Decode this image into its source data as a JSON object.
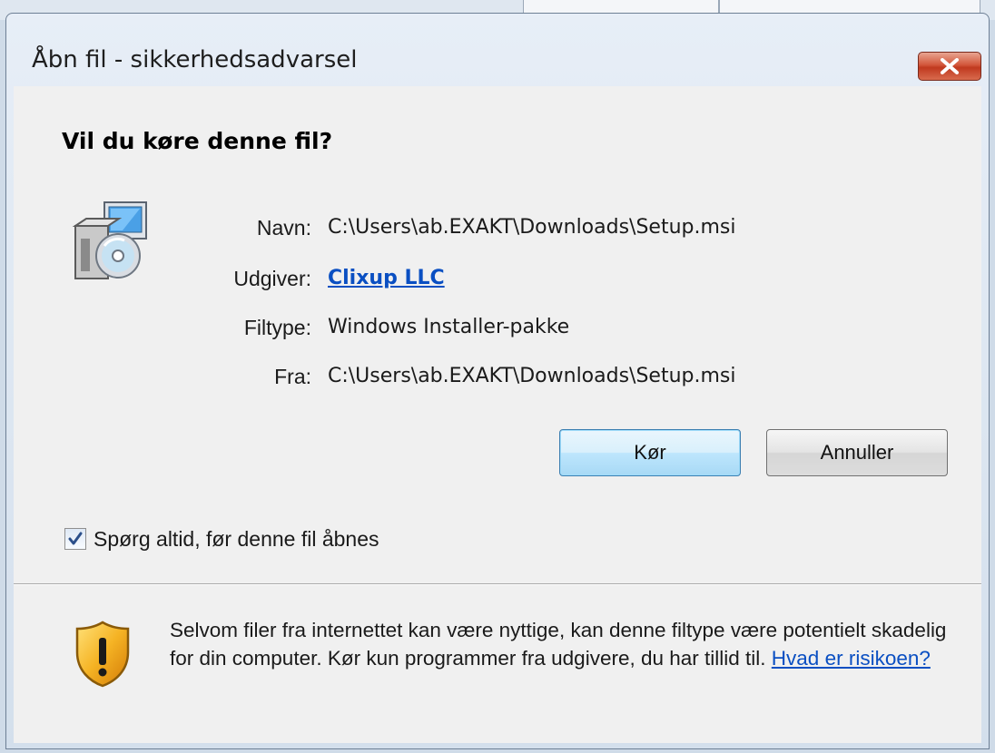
{
  "dialog": {
    "title": "Åbn fil - sikkerhedsadvarsel",
    "heading": "Vil du køre denne fil?",
    "fields": [
      {
        "label": "Navn:",
        "value": "C:\\Users\\ab.EXAKT\\Downloads\\Setup.msi"
      },
      {
        "label": "Udgiver:",
        "value": "Clixup LLC"
      },
      {
        "label": "Filtype:",
        "value": "Windows Installer-pakke"
      },
      {
        "label": "Fra:",
        "value": "C:\\Users\\ab.EXAKT\\Downloads\\Setup.msi"
      }
    ],
    "buttons": {
      "run": "Kør",
      "cancel": "Annuller"
    },
    "checkbox": {
      "label": "Spørg altid, før denne fil åbnes",
      "checked": true
    },
    "warning": {
      "text": "Selvom filer fra internettet kan være nyttige, kan denne filtype være potentielt skadelig for din computer. Kør kun programmer fra udgivere, du har tillid til.",
      "link": "Hvad er risikoen?"
    }
  },
  "icons": {
    "close": "close-icon",
    "app": "installer-package-icon",
    "checkbox": "checkmark-icon",
    "shield": "warning-shield-icon"
  },
  "colors": {
    "link": "#0a4fc2",
    "close_button": "#c0391f",
    "primary_button": "#bee6fd"
  }
}
